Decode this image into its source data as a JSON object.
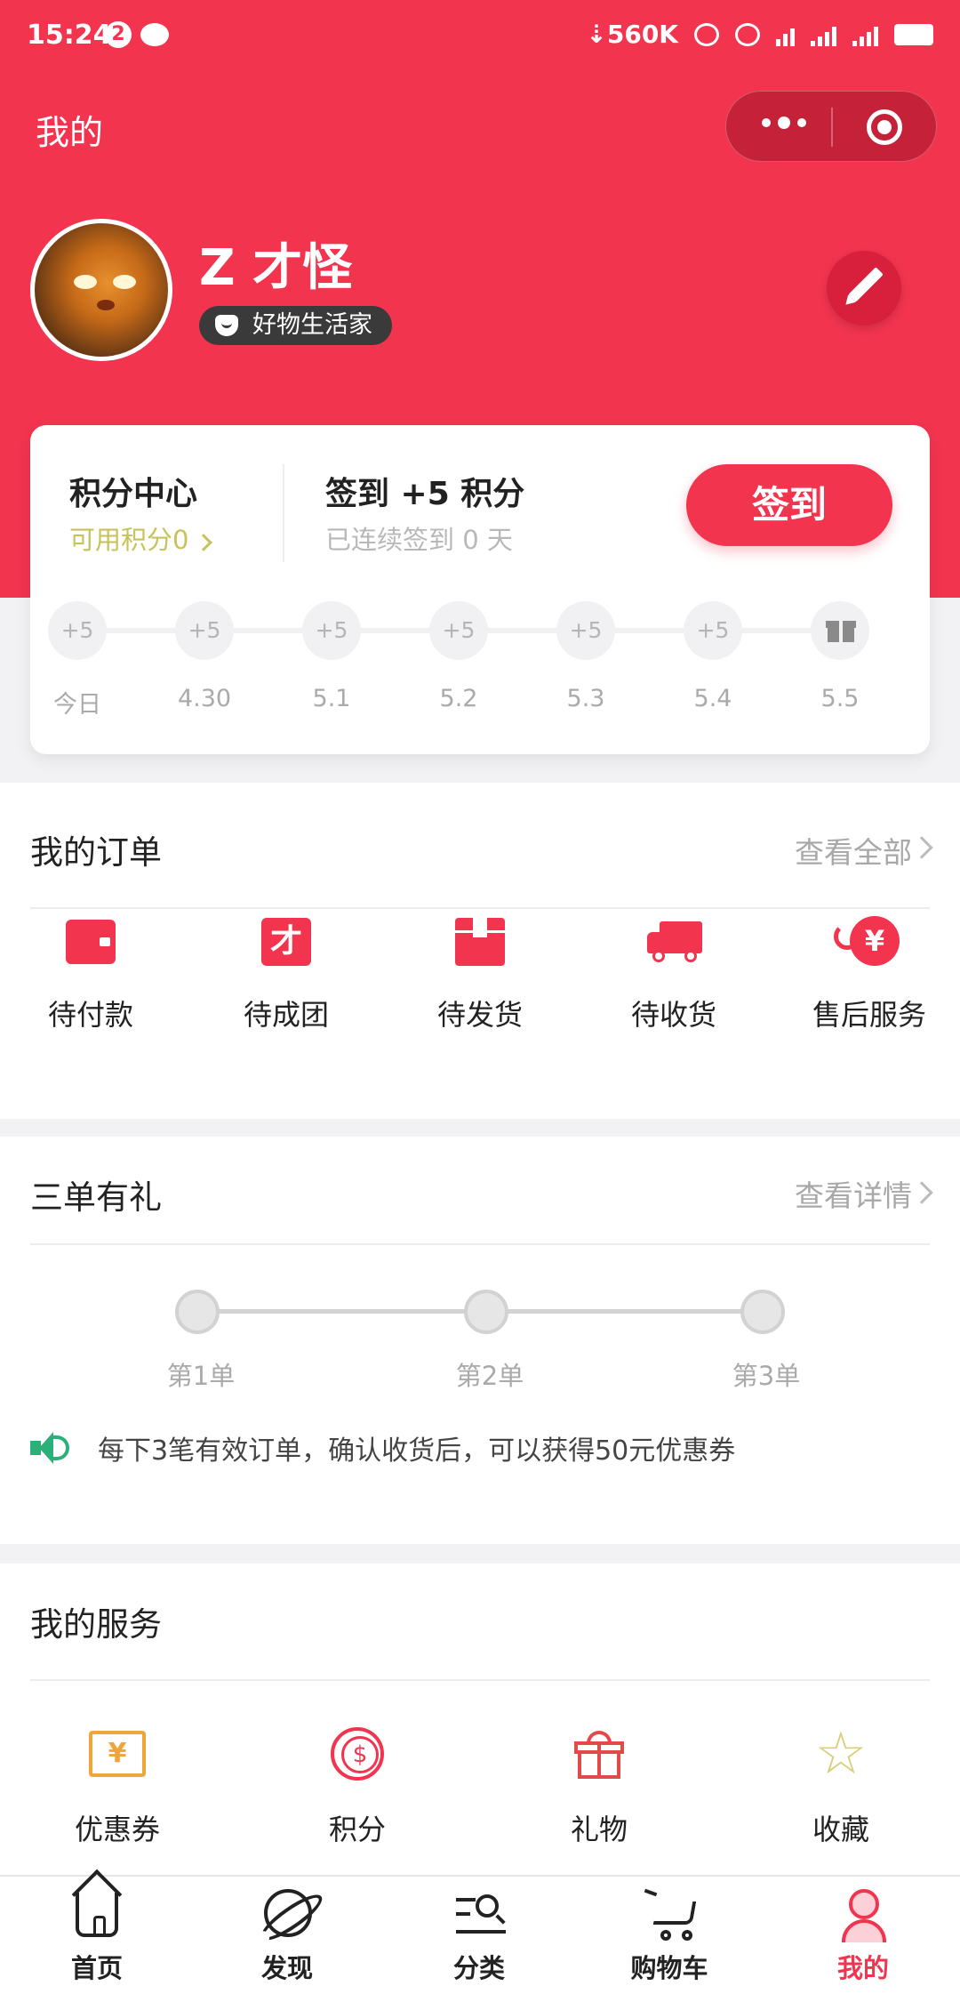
{
  "status_bar": {
    "time": "15:24",
    "notification_count": "2",
    "net_speed": "⇣560K",
    "icons": [
      "chat-icon",
      "alarm-icon",
      "headset-icon",
      "wifi-icon",
      "signal-icon",
      "signal-icon",
      "battery-icon"
    ]
  },
  "nav": {
    "title": "我的"
  },
  "profile": {
    "username": "Z 才怪",
    "badge": "好物生活家"
  },
  "points_card": {
    "title": "积分中心",
    "available": "可用积分0",
    "sign_title": "签到 +5 积分",
    "sign_sub": "已连续签到 0 天",
    "sign_button": "签到",
    "days": [
      {
        "reward": "+5",
        "label": "今日"
      },
      {
        "reward": "+5",
        "label": "4.30"
      },
      {
        "reward": "+5",
        "label": "5.1"
      },
      {
        "reward": "+5",
        "label": "5.2"
      },
      {
        "reward": "+5",
        "label": "5.3"
      },
      {
        "reward": "+5",
        "label": "5.4"
      },
      {
        "reward": "gift-icon",
        "label": "5.5"
      }
    ]
  },
  "orders": {
    "title": "我的订单",
    "more": "查看全部",
    "items": [
      {
        "label": "待付款",
        "icon": "wallet-icon",
        "glyph": ""
      },
      {
        "label": "待成团",
        "icon": "group-icon",
        "glyph": "才"
      },
      {
        "label": "待发货",
        "icon": "box-icon",
        "glyph": ""
      },
      {
        "label": "待收货",
        "icon": "truck-icon",
        "glyph": ""
      },
      {
        "label": "售后服务",
        "icon": "yen-refund-icon",
        "glyph": "¥"
      }
    ]
  },
  "three_orders": {
    "title": "三单有礼",
    "more": "查看详情",
    "steps": [
      "第1单",
      "第2单",
      "第3单"
    ],
    "notice": "每下3笔有效订单，确认收货后，可以获得50元优惠券"
  },
  "services": {
    "title": "我的服务",
    "items": [
      {
        "label": "优惠券",
        "icon": "coupon-icon",
        "glyph": "¥"
      },
      {
        "label": "积分",
        "icon": "points-icon",
        "glyph": ""
      },
      {
        "label": "礼物",
        "icon": "gift-icon",
        "glyph": ""
      },
      {
        "label": "收藏",
        "icon": "star-icon",
        "glyph": "☆"
      }
    ]
  },
  "tabbar": {
    "items": [
      {
        "label": "首页",
        "icon": "home-icon"
      },
      {
        "label": "发现",
        "icon": "planet-icon"
      },
      {
        "label": "分类",
        "icon": "category-search-icon"
      },
      {
        "label": "购物车",
        "icon": "cart-icon"
      },
      {
        "label": "我的",
        "icon": "user-icon",
        "active": true
      }
    ]
  },
  "colors": {
    "brand": "#f2344f",
    "points_gold": "#c7c25a",
    "notice_green": "#2bb07a"
  }
}
